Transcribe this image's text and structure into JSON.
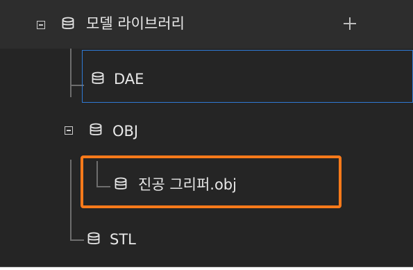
{
  "header": {
    "title": "모델 라이브러리",
    "add_icon": "plus-icon"
  },
  "tree": {
    "dae_label": "DAE",
    "obj_label": "OBJ",
    "obj_child_label": "진공 그리퍼.obj",
    "stl_label": "STL"
  },
  "colors": {
    "selection_border": "#2f7ad6",
    "highlight_border": "#ff7a1a",
    "panel_bg": "#252525",
    "header_bg": "#2d2d2d"
  }
}
